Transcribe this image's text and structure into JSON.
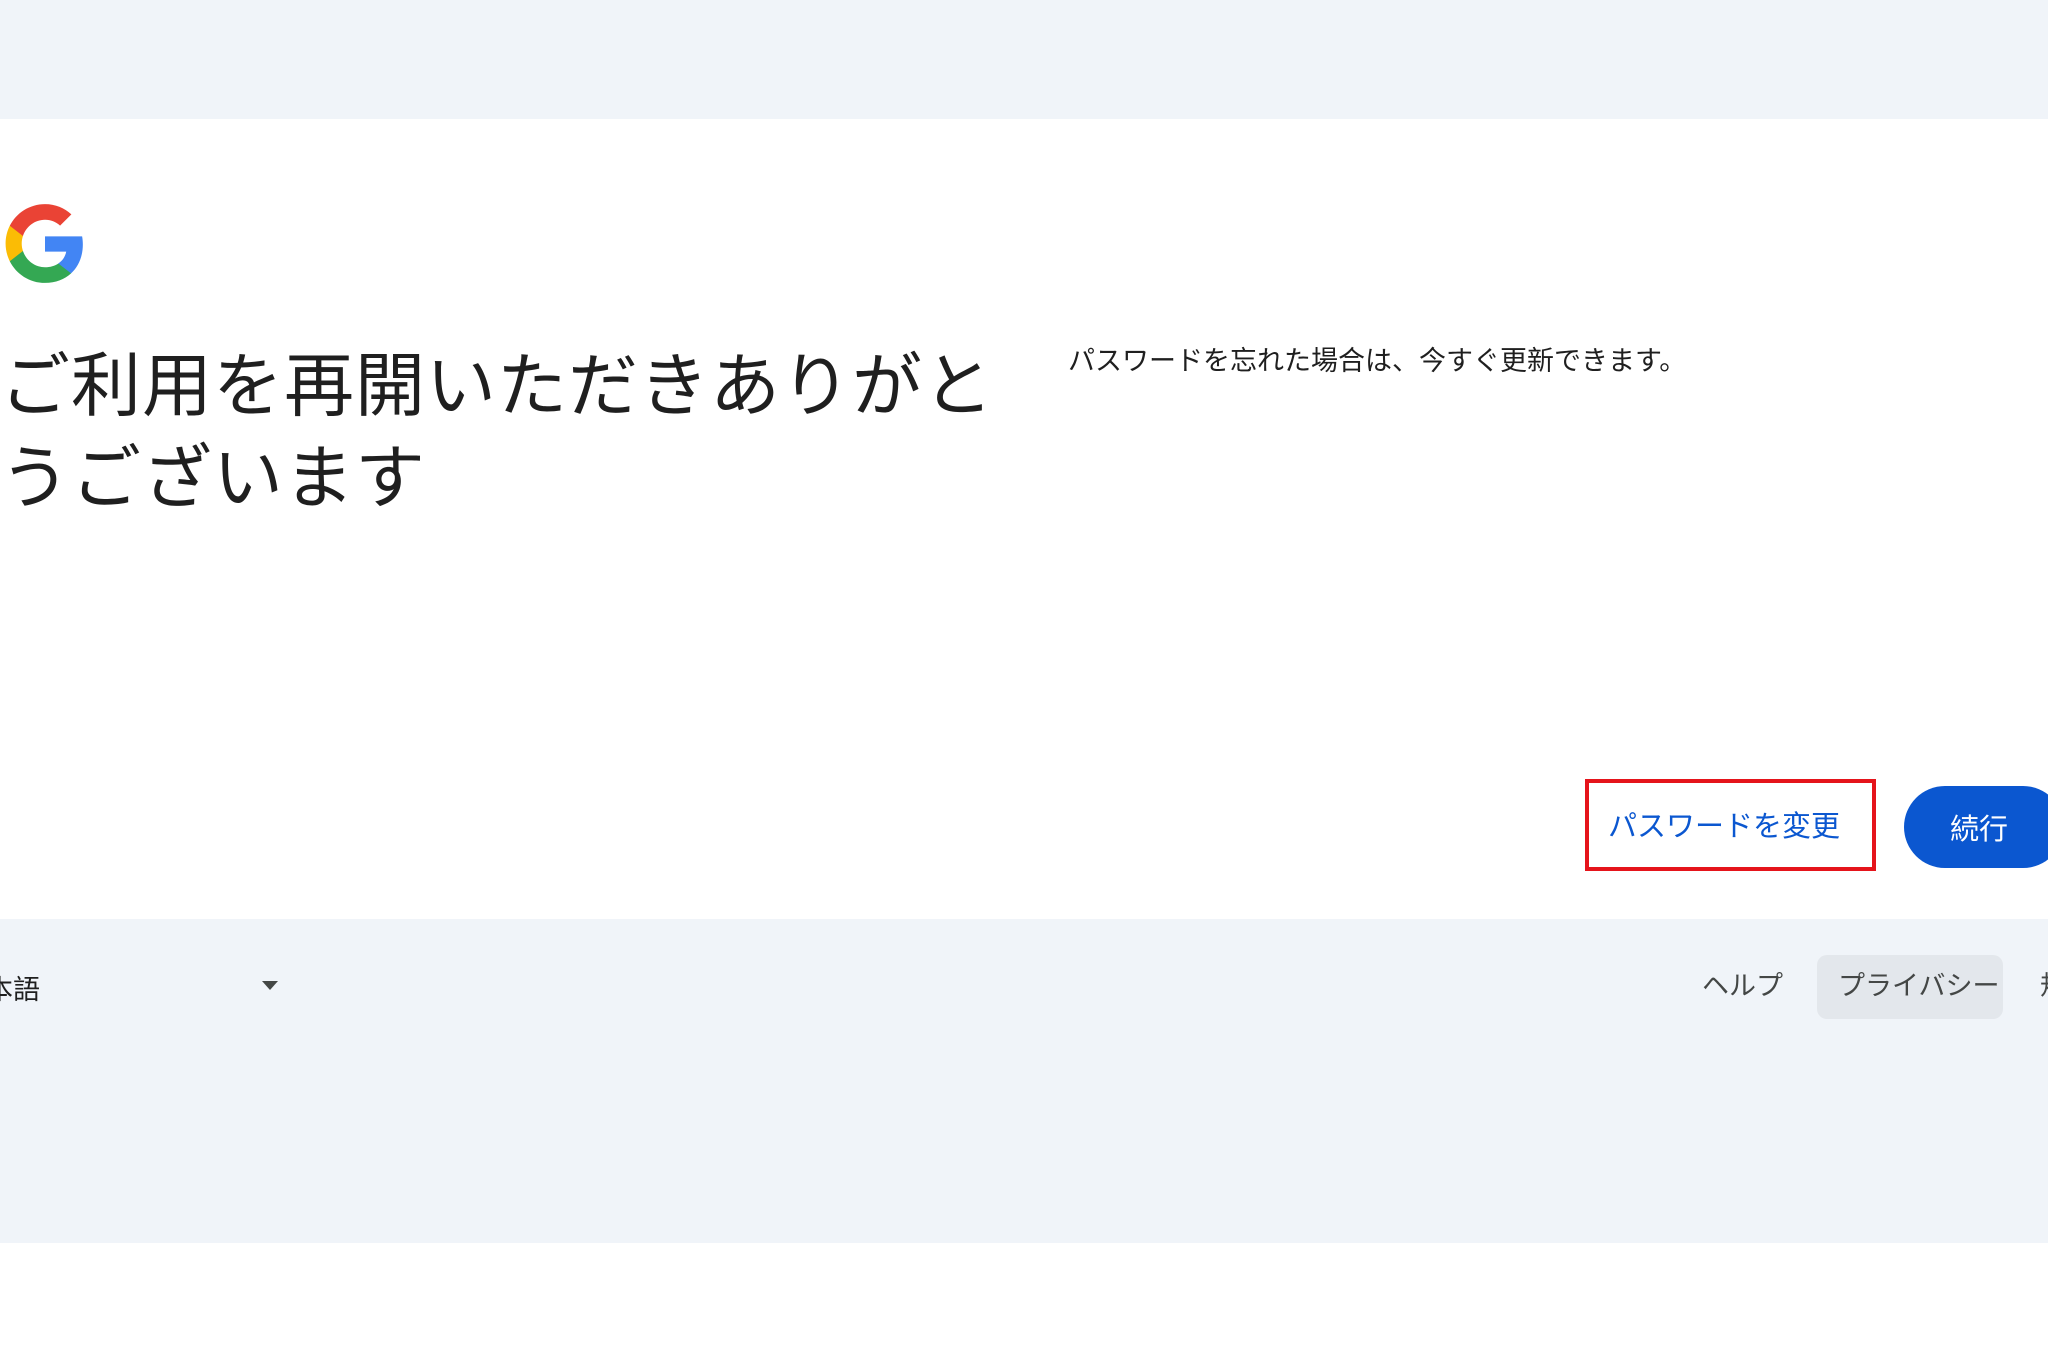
{
  "header": {
    "logo_icon": "google-g-logo-icon"
  },
  "main": {
    "title_line1": "ご利用を再開いただきありがと",
    "title_line2": "うございます",
    "description": "パスワードを忘れた場合は、今すぐ更新できます。",
    "change_password_label": "パスワードを変更",
    "continue_label": "続行"
  },
  "footer": {
    "language": "本語",
    "help": "ヘルプ",
    "privacy": "プライバシー",
    "terms": "規"
  },
  "colors": {
    "page_background": "#f0f4f9",
    "card_background": "#ffffff",
    "primary": "#0b57d0",
    "highlight_border": "#e5141b"
  }
}
